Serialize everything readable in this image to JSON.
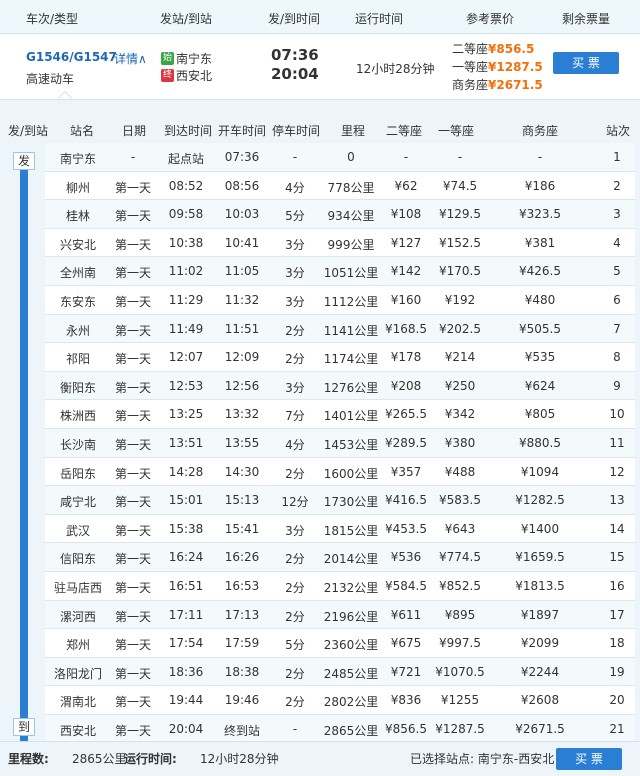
{
  "header": {
    "col_train": "车次/类型",
    "col_stations": "发站/到站",
    "col_times": "发/到时间",
    "col_duration": "运行时间",
    "col_price": "参考票价",
    "col_remaining": "剩余票量"
  },
  "train": {
    "number": "G1546/G1547",
    "detail_label": "详情∧",
    "type": "高速动车",
    "from_badge": "始",
    "from_station": "南宁东",
    "to_badge": "终",
    "to_station": "西安北",
    "depart_time": "07:36",
    "arrive_time": "20:04",
    "duration": "12小时28分钟",
    "prices": [
      {
        "label": "二等座",
        "value": "¥856.5"
      },
      {
        "label": "一等座",
        "value": "¥1287.5"
      },
      {
        "label": "商务座",
        "value": "¥2671.5"
      }
    ],
    "buy_label": "买 票"
  },
  "table": {
    "columns": [
      "发/到站",
      "站名",
      "日期",
      "到达时间",
      "开车时间",
      "停车时间",
      "里程",
      "二等座",
      "一等座",
      "商务座",
      "站次"
    ],
    "depart_tag": "发",
    "arrive_tag": "到",
    "rows": [
      {
        "name": "南宁东",
        "day": "-",
        "arr": "起点站",
        "dep": "07:36",
        "stop": "-",
        "km": "0",
        "s2": "-",
        "s1": "-",
        "sb": "-",
        "no": "1"
      },
      {
        "name": "柳州",
        "day": "第一天",
        "arr": "08:52",
        "dep": "08:56",
        "stop": "4分",
        "km": "778公里",
        "s2": "¥62",
        "s1": "¥74.5",
        "sb": "¥186",
        "no": "2"
      },
      {
        "name": "桂林",
        "day": "第一天",
        "arr": "09:58",
        "dep": "10:03",
        "stop": "5分",
        "km": "934公里",
        "s2": "¥108",
        "s1": "¥129.5",
        "sb": "¥323.5",
        "no": "3"
      },
      {
        "name": "兴安北",
        "day": "第一天",
        "arr": "10:38",
        "dep": "10:41",
        "stop": "3分",
        "km": "999公里",
        "s2": "¥127",
        "s1": "¥152.5",
        "sb": "¥381",
        "no": "4"
      },
      {
        "name": "全州南",
        "day": "第一天",
        "arr": "11:02",
        "dep": "11:05",
        "stop": "3分",
        "km": "1051公里",
        "s2": "¥142",
        "s1": "¥170.5",
        "sb": "¥426.5",
        "no": "5"
      },
      {
        "name": "东安东",
        "day": "第一天",
        "arr": "11:29",
        "dep": "11:32",
        "stop": "3分",
        "km": "1112公里",
        "s2": "¥160",
        "s1": "¥192",
        "sb": "¥480",
        "no": "6"
      },
      {
        "name": "永州",
        "day": "第一天",
        "arr": "11:49",
        "dep": "11:51",
        "stop": "2分",
        "km": "1141公里",
        "s2": "¥168.5",
        "s1": "¥202.5",
        "sb": "¥505.5",
        "no": "7"
      },
      {
        "name": "祁阳",
        "day": "第一天",
        "arr": "12:07",
        "dep": "12:09",
        "stop": "2分",
        "km": "1174公里",
        "s2": "¥178",
        "s1": "¥214",
        "sb": "¥535",
        "no": "8"
      },
      {
        "name": "衡阳东",
        "day": "第一天",
        "arr": "12:53",
        "dep": "12:56",
        "stop": "3分",
        "km": "1276公里",
        "s2": "¥208",
        "s1": "¥250",
        "sb": "¥624",
        "no": "9"
      },
      {
        "name": "株洲西",
        "day": "第一天",
        "arr": "13:25",
        "dep": "13:32",
        "stop": "7分",
        "km": "1401公里",
        "s2": "¥265.5",
        "s1": "¥342",
        "sb": "¥805",
        "no": "10"
      },
      {
        "name": "长沙南",
        "day": "第一天",
        "arr": "13:51",
        "dep": "13:55",
        "stop": "4分",
        "km": "1453公里",
        "s2": "¥289.5",
        "s1": "¥380",
        "sb": "¥880.5",
        "no": "11"
      },
      {
        "name": "岳阳东",
        "day": "第一天",
        "arr": "14:28",
        "dep": "14:30",
        "stop": "2分",
        "km": "1600公里",
        "s2": "¥357",
        "s1": "¥488",
        "sb": "¥1094",
        "no": "12"
      },
      {
        "name": "咸宁北",
        "day": "第一天",
        "arr": "15:01",
        "dep": "15:13",
        "stop": "12分",
        "km": "1730公里",
        "s2": "¥416.5",
        "s1": "¥583.5",
        "sb": "¥1282.5",
        "no": "13"
      },
      {
        "name": "武汉",
        "day": "第一天",
        "arr": "15:38",
        "dep": "15:41",
        "stop": "3分",
        "km": "1815公里",
        "s2": "¥453.5",
        "s1": "¥643",
        "sb": "¥1400",
        "no": "14"
      },
      {
        "name": "信阳东",
        "day": "第一天",
        "arr": "16:24",
        "dep": "16:26",
        "stop": "2分",
        "km": "2014公里",
        "s2": "¥536",
        "s1": "¥774.5",
        "sb": "¥1659.5",
        "no": "15"
      },
      {
        "name": "驻马店西",
        "day": "第一天",
        "arr": "16:51",
        "dep": "16:53",
        "stop": "2分",
        "km": "2132公里",
        "s2": "¥584.5",
        "s1": "¥852.5",
        "sb": "¥1813.5",
        "no": "16"
      },
      {
        "name": "漯河西",
        "day": "第一天",
        "arr": "17:11",
        "dep": "17:13",
        "stop": "2分",
        "km": "2196公里",
        "s2": "¥611",
        "s1": "¥895",
        "sb": "¥1897",
        "no": "17"
      },
      {
        "name": "郑州",
        "day": "第一天",
        "arr": "17:54",
        "dep": "17:59",
        "stop": "5分",
        "km": "2360公里",
        "s2": "¥675",
        "s1": "¥997.5",
        "sb": "¥2099",
        "no": "18"
      },
      {
        "name": "洛阳龙门",
        "day": "第一天",
        "arr": "18:36",
        "dep": "18:38",
        "stop": "2分",
        "km": "2485公里",
        "s2": "¥721",
        "s1": "¥1070.5",
        "sb": "¥2244",
        "no": "19"
      },
      {
        "name": "渭南北",
        "day": "第一天",
        "arr": "19:44",
        "dep": "19:46",
        "stop": "2分",
        "km": "2802公里",
        "s2": "¥836",
        "s1": "¥1255",
        "sb": "¥2608",
        "no": "20"
      },
      {
        "name": "西安北",
        "day": "第一天",
        "arr": "20:04",
        "dep": "终到站",
        "stop": "-",
        "km": "2865公里",
        "s2": "¥856.5",
        "s1": "¥1287.5",
        "sb": "¥2671.5",
        "no": "21"
      }
    ]
  },
  "footer": {
    "mileage_label": "里程数:",
    "mileage_value": "2865公里",
    "runtime_label": "运行时间:",
    "runtime_value": "12小时28分钟",
    "selected_label": "已选择站点: 南宁东-西安北",
    "buy_label": "买 票"
  },
  "colors": {
    "accent": "#2a7fd4",
    "price": "#f4700a",
    "link": "#2067b4"
  }
}
